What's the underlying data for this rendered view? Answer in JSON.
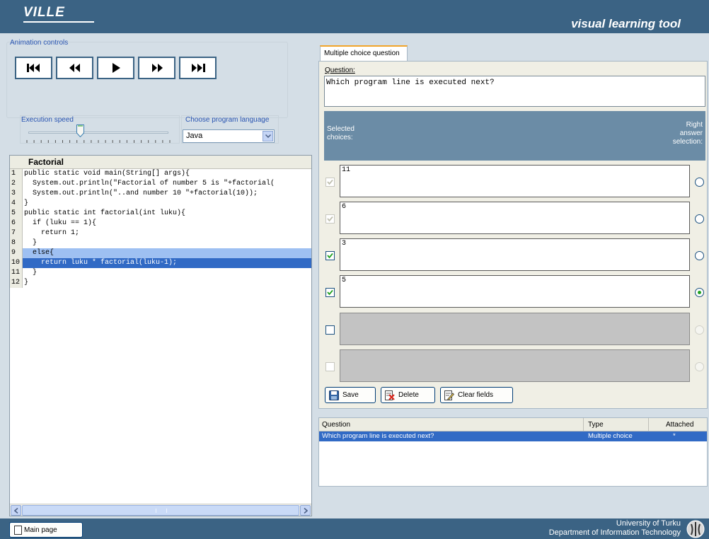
{
  "header": {
    "logo": "VILLE",
    "tagline": "visual learning tool"
  },
  "animation": {
    "title": "Animation controls",
    "buttons": [
      "skip-to-start",
      "step-back",
      "play",
      "step-forward",
      "skip-to-end"
    ],
    "speed_label": "Execution speed",
    "speed_level": 0.37,
    "language_label": "Choose program language",
    "language_value": "Java"
  },
  "code": {
    "title": "Factorial",
    "lines": [
      {
        "num": "1",
        "text": "public static void main(String[] args){"
      },
      {
        "num": "2",
        "text": "  System.out.println(\"Factorial of number 5 is \"+factorial("
      },
      {
        "num": "3",
        "text": "  System.out.println(\"..and number 10 \"+factorial(10));"
      },
      {
        "num": "4",
        "text": "}"
      },
      {
        "num": "5",
        "text": "public static int factorial(int luku){"
      },
      {
        "num": "6",
        "text": "  if (luku == 1){"
      },
      {
        "num": "7",
        "text": "    return 1;"
      },
      {
        "num": "8",
        "text": "  }"
      },
      {
        "num": "9",
        "text": "  else{"
      },
      {
        "num": "10",
        "text": "    return luku * factorial(luku-1);"
      },
      {
        "num": "11",
        "text": "  }"
      },
      {
        "num": "12",
        "text": "}"
      }
    ],
    "highlight_light": "9",
    "highlight_dark": "10"
  },
  "question_editor": {
    "tab_label": "Multiple choice question",
    "question_label": "Question:",
    "question_text": "Which program line is executed next?",
    "selected_header": "Selected\nchoices:",
    "right_header": "Right\nanswer\nselection:",
    "choices": [
      {
        "text": "11",
        "checked": true,
        "check_disabled": true,
        "right": false,
        "enabled": true
      },
      {
        "text": "6",
        "checked": true,
        "check_disabled": true,
        "right": false,
        "enabled": true
      },
      {
        "text": "3",
        "checked": true,
        "check_disabled": false,
        "right": false,
        "enabled": true
      },
      {
        "text": "5",
        "checked": true,
        "check_disabled": false,
        "right": true,
        "enabled": true
      },
      {
        "text": "",
        "checked": false,
        "check_disabled": false,
        "right": false,
        "enabled": false
      },
      {
        "text": "",
        "checked": false,
        "check_disabled": true,
        "right": false,
        "enabled": false
      }
    ],
    "save_label": "Save",
    "delete_label": "Delete",
    "clear_label": "Clear fields"
  },
  "question_list": {
    "col_question": "Question",
    "col_type": "Type",
    "col_attached": "Attached",
    "rows": [
      {
        "question": "Which program line is executed next?",
        "type": "Multiple choice",
        "attached": "*"
      }
    ]
  },
  "footer": {
    "main_page": "Main page",
    "university": "University of Turku",
    "department": "Department of Information Technology"
  },
  "colors": {
    "header_bg": "#3b6384",
    "highlight_light": "#9ec0f2",
    "highlight_dark": "#316ac5",
    "accent_tab": "#f2a42a"
  }
}
